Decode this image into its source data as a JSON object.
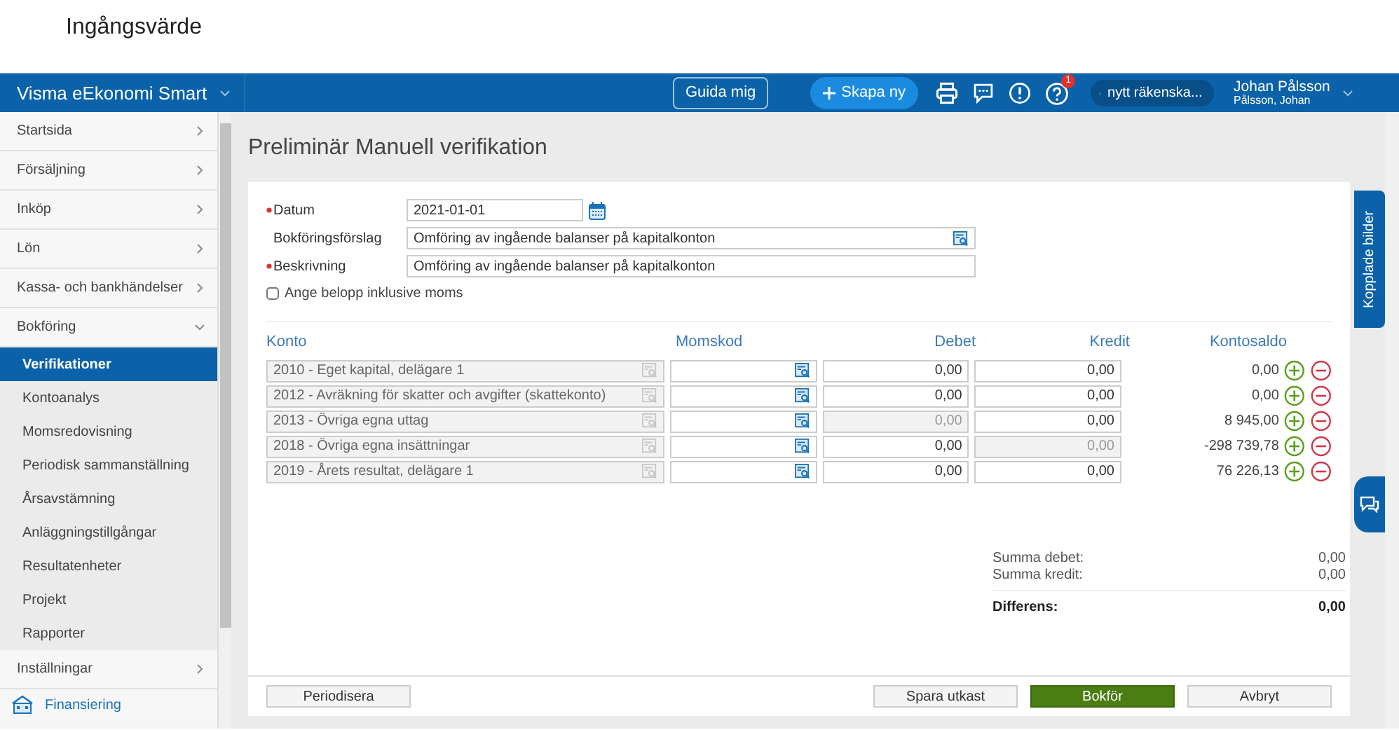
{
  "page_title": "Ingångsvärde",
  "navbar": {
    "brand": "Visma eEkonomi Smart",
    "guide_button": "Guida mig",
    "create_button": "Skapa ny",
    "help_badge": "1",
    "search": {
      "value": "nytt räkenska..."
    },
    "user": {
      "name": "Johan Pålsson",
      "company": "Pålsson, Johan"
    }
  },
  "sidebar": {
    "items": [
      {
        "label": "Startsida",
        "kind": "group",
        "expanded": false
      },
      {
        "label": "Försäljning",
        "kind": "group",
        "expanded": false
      },
      {
        "label": "Inköp",
        "kind": "group",
        "expanded": false
      },
      {
        "label": "Lön",
        "kind": "group",
        "expanded": false
      },
      {
        "label": "Kassa- och bankhändelser",
        "kind": "group",
        "expanded": false
      },
      {
        "label": "Bokföring",
        "kind": "group",
        "expanded": true,
        "children": [
          {
            "label": "Verifikationer",
            "selected": true
          },
          {
            "label": "Kontoanalys",
            "selected": false
          },
          {
            "label": "Momsredovisning",
            "selected": false
          },
          {
            "label": "Periodisk sammanställning",
            "selected": false
          },
          {
            "label": "Årsavstämning",
            "selected": false
          },
          {
            "label": "Anläggningstillgångar",
            "selected": false
          },
          {
            "label": "Resultatenheter",
            "selected": false
          },
          {
            "label": "Projekt",
            "selected": false
          },
          {
            "label": "Rapporter",
            "selected": false
          }
        ]
      },
      {
        "label": "Inställningar",
        "kind": "group",
        "expanded": false
      },
      {
        "label": "Finansiering",
        "kind": "link"
      }
    ]
  },
  "heading": "Preliminär Manuell verifikation",
  "form": {
    "fields": [
      {
        "label": "Datum",
        "required": true,
        "value": "2021-01-01",
        "kind": "date"
      },
      {
        "label": "Bokföringsförslag",
        "required": false,
        "value": "Omföring av ingående balanser på kapitalkonton",
        "kind": "lookup"
      },
      {
        "label": "Beskrivning",
        "required": true,
        "value": "Omföring av ingående balanser på kapitalkonton",
        "kind": "text"
      }
    ],
    "checkbox": {
      "label": "Ange belopp inklusive moms",
      "checked": false
    }
  },
  "table": {
    "columns": [
      "Konto",
      "Momskod",
      "Debet",
      "Kredit",
      "Kontosaldo"
    ],
    "rows": [
      {
        "konto": "2010 - Eget kapital, delägare 1",
        "debet": {
          "value": "0,00",
          "disabled": false
        },
        "kredit": {
          "value": "0,00",
          "disabled": false
        },
        "saldo": "0,00"
      },
      {
        "konto": "2012 - Avräkning för skatter och avgifter (skattekonto)",
        "debet": {
          "value": "0,00",
          "disabled": false
        },
        "kredit": {
          "value": "0,00",
          "disabled": false
        },
        "saldo": "0,00"
      },
      {
        "konto": "2013 - Övriga egna uttag",
        "debet": {
          "value": "0,00",
          "disabled": true
        },
        "kredit": {
          "value": "0,00",
          "disabled": false
        },
        "saldo": "8 945,00"
      },
      {
        "konto": "2018 - Övriga egna insättningar",
        "debet": {
          "value": "0,00",
          "disabled": false
        },
        "kredit": {
          "value": "0,00",
          "disabled": true
        },
        "saldo": "-298 739,78"
      },
      {
        "konto": "2019 - Årets resultat, delägare 1",
        "debet": {
          "value": "0,00",
          "disabled": false
        },
        "kredit": {
          "value": "0,00",
          "disabled": false
        },
        "saldo": "76 226,13"
      }
    ]
  },
  "totals": [
    {
      "label": "Summa debet:",
      "value": "0,00",
      "bold": false
    },
    {
      "label": "Summa kredit:",
      "value": "0,00",
      "bold": false
    },
    {
      "label": "Differens:",
      "value": "0,00",
      "bold": true
    }
  ],
  "footer": {
    "left_button": "Periodisera",
    "buttons": [
      {
        "label": "Spara utkast",
        "kind": "secondary"
      },
      {
        "label": "Bokför",
        "kind": "primary"
      },
      {
        "label": "Avbryt",
        "kind": "secondary"
      }
    ]
  },
  "side_tab": "Kopplade bilder"
}
